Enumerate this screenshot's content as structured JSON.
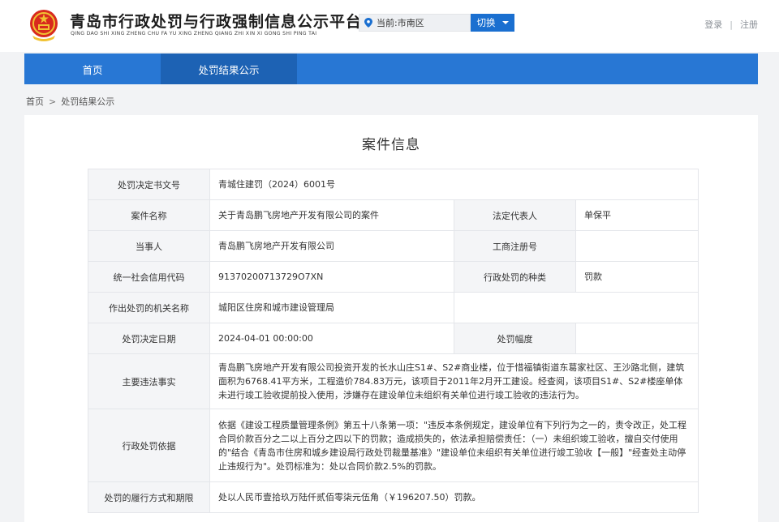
{
  "header": {
    "title": "青岛市行政处罚与行政强制信息公示平台",
    "subtitle": "QING DAO SHI XING ZHENG CHU FA YU XING ZHENG QIANG ZHI XIN XI GONG SHI PING TAI",
    "location_label": "当前:市南区",
    "switch_label": "切换",
    "login_label": "登录",
    "separator": "|",
    "register_label": "注册"
  },
  "nav": {
    "items": [
      {
        "label": "首页"
      },
      {
        "label": "处罚结果公示"
      }
    ]
  },
  "breadcrumb": {
    "home": "首页",
    "gt": ">",
    "current": "处罚结果公示"
  },
  "case": {
    "title": "案件信息",
    "rows": {
      "doc_no_label": "处罚决定书文号",
      "doc_no": "青城住建罚（2024）6001号",
      "case_name_label": "案件名称",
      "case_name": "关于青岛鹏飞房地产开发有限公司的案件",
      "legal_rep_label": "法定代表人",
      "legal_rep": "单保平",
      "party_label": "当事人",
      "party": "青岛鹏飞房地产开发有限公司",
      "biz_reg_label": "工商注册号",
      "biz_reg": "",
      "credit_code_label": "统一社会信用代码",
      "credit_code": "91370200713729O7XN",
      "penalty_type_label": "行政处罚的种类",
      "penalty_type": "罚款",
      "authority_label": "作出处罚的机关名称",
      "authority": "城阳区住房和城市建设管理局",
      "decision_date_label": "处罚决定日期",
      "decision_date": "2024-04-01 00:00:00",
      "penalty_range_label": "处罚幅度",
      "penalty_range": "",
      "facts_label": "主要违法事实",
      "facts": "青岛鹏飞房地产开发有限公司投资开发的长水山庄S1#、S2#商业楼，位于惜福镇街道东葛家社区、王沙路北侧，建筑面积为6768.41平方米，工程造价784.83万元，该项目于2011年2月开工建设。经查阅，该项目S1#、S2#楼座单体未进行竣工验收提前投入使用，涉嫌存在建设单位未组织有关单位进行竣工验收的违法行为。",
      "basis_label": "行政处罚依据",
      "basis": "依据《建设工程质量管理条例》第五十八条第一项：\"违反本条例规定，建设单位有下列行为之一的，责令改正，处工程合同价款百分之二以上百分之四以下的罚款；造成损失的，依法承担赔偿责任：（一）未组织竣工验收，擅自交付使用的\"结合《青岛市住房和城乡建设局行政处罚裁量基准》\"建设单位未组织有关单位进行竣工验收【一般】\"经查处主动停止违规行为\"。处罚标准为：处以合同价款2.5%的罚款。",
      "execution_label": "处罚的履行方式和期限",
      "execution": "处以人民币壹拾玖万陆仟贰佰零柒元伍角（￥196207.50）罚款。"
    }
  },
  "colors": {
    "brand_blue": "#2877d4",
    "nav_active": "#1d62b4",
    "button_blue": "#1a6fd0"
  }
}
